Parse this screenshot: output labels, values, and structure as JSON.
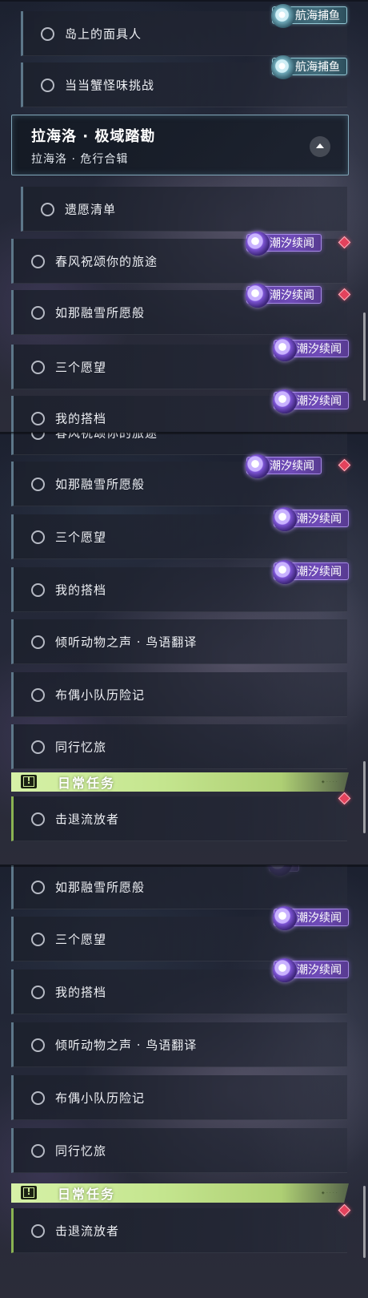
{
  "tags": {
    "sea_fishing": "航海捕鱼",
    "tide_tales": "潮汐续闻"
  },
  "panel1": {
    "items_top": [
      {
        "label": "岛上的面具人",
        "tag": "航海捕鱼"
      },
      {
        "label": "当当蟹怪味挑战",
        "tag": "航海捕鱼"
      }
    ],
    "region": {
      "title": "拉海洛 · 极域踏勘",
      "subtitle": "拉海洛 · 危行合辑"
    },
    "sub_item": {
      "label": "遗愿清单"
    },
    "items": [
      {
        "label": "春风祝颂你的旅途",
        "tag": "潮汐续闻"
      },
      {
        "label": "如那融雪所愿般",
        "tag": "潮汐续闻"
      },
      {
        "label": "三个愿望",
        "tag": "潮汐续闻"
      },
      {
        "label": "我的搭档",
        "tag": "潮汐续闻"
      }
    ]
  },
  "panel2": {
    "items": [
      {
        "label": "春风祝颂你的旅途"
      },
      {
        "label": "如那融雪所愿般",
        "tag": "潮汐续闻"
      },
      {
        "label": "三个愿望",
        "tag": "潮汐续闻"
      },
      {
        "label": "我的搭档",
        "tag": "潮汐续闻"
      },
      {
        "label": "倾听动物之声 · 鸟语翻译"
      },
      {
        "label": "布偶小队历险记"
      },
      {
        "label": "同行忆旅"
      }
    ],
    "daily_header": "日常任务",
    "daily_item": "击退流放者"
  },
  "panel3": {
    "items": [
      {
        "label": "如那融雪所愿般"
      },
      {
        "label": "三个愿望",
        "tag": "潮汐续闻"
      },
      {
        "label": "我的搭档",
        "tag": "潮汐续闻"
      },
      {
        "label": "倾听动物之声 · 鸟语翻译"
      },
      {
        "label": "布偶小队历险记"
      },
      {
        "label": "同行忆旅"
      }
    ],
    "daily_header": "日常任务",
    "daily_item": "击退流放者"
  },
  "daily_icon_glyph": "!",
  "colors": {
    "tide_tag": "#6f4bb8",
    "fishing_tag": "#436d7c",
    "daily_header": "#c4e58e",
    "marker": "#e3425c"
  }
}
